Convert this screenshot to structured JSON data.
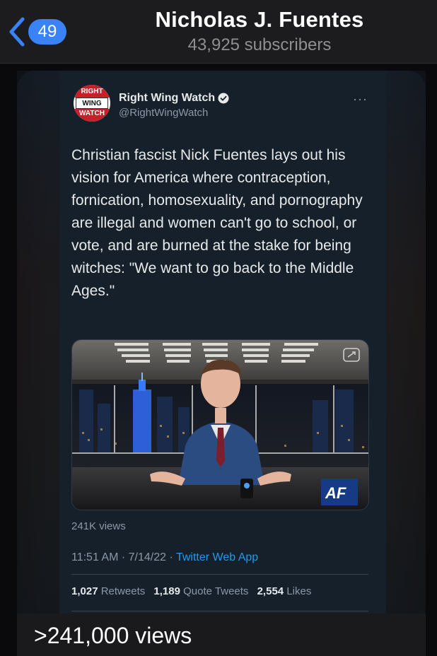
{
  "header": {
    "unread_count": "49",
    "channel_name": "Nicholas J. Fuentes",
    "subscribers": "43,925 subscribers"
  },
  "tweet": {
    "avatar_text": [
      "RIGHT",
      "WING",
      "WATCH"
    ],
    "author_name": "Right Wing Watch",
    "handle": "@RightWingWatch",
    "more_label": "···",
    "body": "Christian fascist Nick Fuentes lays out his vision for America where contraception, fornication, homosexuality, and pornography are illegal and women can't go to school, or vote, and are burned at the stake for being witches: \"We want to go back to the Middle Ages.\"",
    "video_views": "241K views",
    "time": "11:51 AM · 7/14/22 · ",
    "source": "Twitter Web App",
    "retweets_count": "1,027",
    "retweets_label": "Retweets",
    "quotes_count": "1,189",
    "quotes_label": "Quote Tweets",
    "likes_count": "2,554",
    "likes_label": "Likes",
    "video_logo": "AF"
  },
  "caption": ">241,000 views",
  "colors": {
    "accent_blue": "#3a82f7",
    "twitter_blue": "#1d9bf0",
    "tweet_bg": "#15202b",
    "rww_red": "#c8202b"
  }
}
